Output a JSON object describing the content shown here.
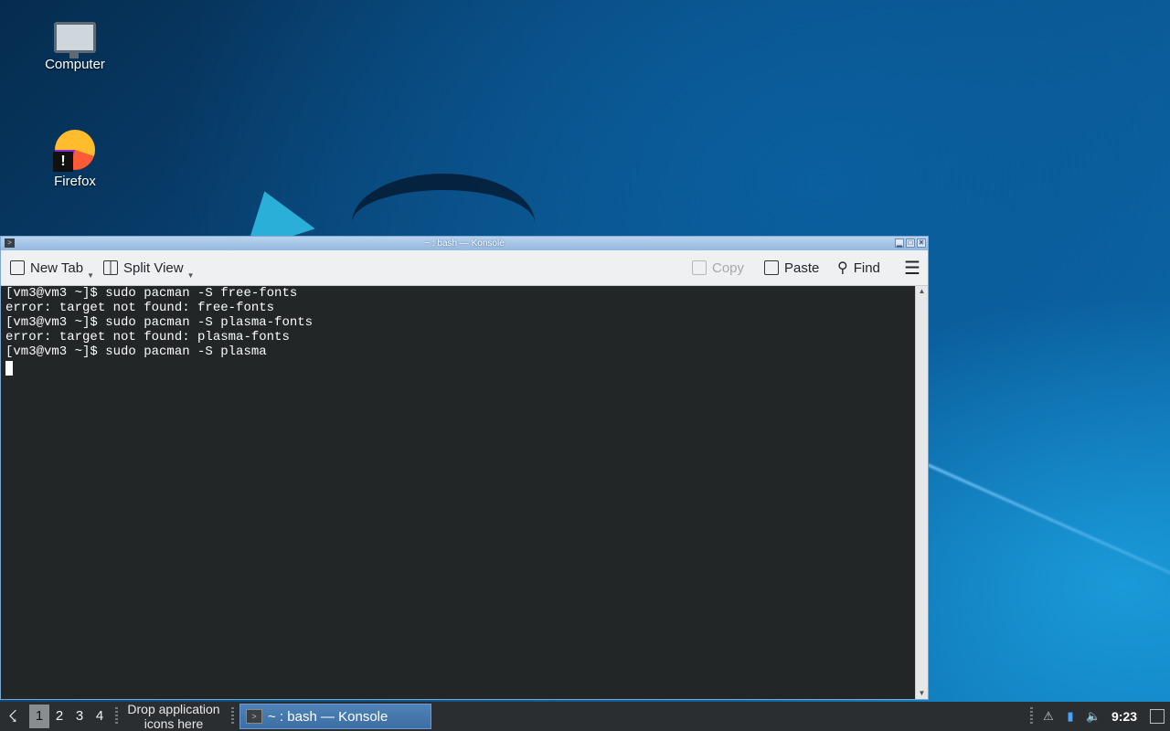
{
  "desktop": {
    "icons": [
      {
        "label": "Computer",
        "icon": "computer-icon"
      },
      {
        "label": "Firefox",
        "icon": "firefox-icon",
        "badge": "!"
      }
    ]
  },
  "window": {
    "title": "~ : bash — Konsole",
    "app_icon": ">",
    "buttons": {
      "minimize": "▁",
      "maximize": "□",
      "close": "✕"
    }
  },
  "toolbar": {
    "new_tab": "New Tab",
    "split_view": "Split View",
    "copy": "Copy",
    "paste": "Paste",
    "find": "Find",
    "menu_icon": "hamburger-menu-icon"
  },
  "terminal": {
    "lines": [
      "[vm3@vm3 ~]$ sudo pacman -S free-fonts",
      "error: target not found: free-fonts",
      "[vm3@vm3 ~]$ sudo pacman -S plasma-fonts",
      "error: target not found: plasma-fonts",
      "[vm3@vm3 ~]$ sudo pacman -S plasma"
    ]
  },
  "taskbar": {
    "desktops": [
      "1",
      "2",
      "3",
      "4"
    ],
    "active_desktop": "1",
    "drop_text_line1": "Drop application",
    "drop_text_line2": "icons here",
    "task_label": "~ : bash — Konsole",
    "clock": "9:23"
  },
  "colors": {
    "terminal_bg": "#232627",
    "terminal_fg": "#fcfcfc",
    "taskbar_bg": "#2b2e31",
    "active_task": "#3c6ea3"
  }
}
